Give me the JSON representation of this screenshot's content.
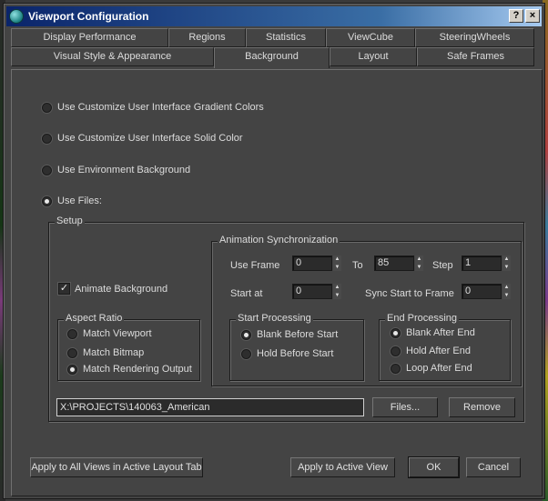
{
  "window": {
    "title": "Viewport Configuration",
    "help_label": "?",
    "close_label": "×"
  },
  "tabs_row1": [
    {
      "label": "Display Performance"
    },
    {
      "label": "Regions"
    },
    {
      "label": "Statistics"
    },
    {
      "label": "ViewCube"
    },
    {
      "label": "SteeringWheels"
    }
  ],
  "tabs_row2": [
    {
      "label": "Visual Style & Appearance"
    },
    {
      "label": "Background",
      "active": true
    },
    {
      "label": "Layout"
    },
    {
      "label": "Safe Frames"
    }
  ],
  "background_options": [
    {
      "label": "Use Customize User Interface Gradient Colors",
      "selected": false
    },
    {
      "label": "Use Customize User Interface Solid Color",
      "selected": false
    },
    {
      "label": "Use Environment Background",
      "selected": false
    },
    {
      "label": "Use Files:",
      "selected": true
    }
  ],
  "setup": {
    "title": "Setup",
    "animate_background": {
      "label": "Animate Background",
      "checked": true,
      "mark": "✓"
    },
    "aspect_ratio": {
      "title": "Aspect Ratio",
      "options": [
        {
          "label": "Match Viewport",
          "selected": false
        },
        {
          "label": "Match Bitmap",
          "selected": false
        },
        {
          "label": "Match Rendering Output",
          "selected": true
        }
      ]
    },
    "anim_sync": {
      "title": "Animation Synchronization",
      "use_frame_label": "Use Frame",
      "use_frame_value": "0",
      "to_label": "To",
      "to_value": "85",
      "step_label": "Step",
      "step_value": "1",
      "start_at_label": "Start at",
      "start_at_value": "0",
      "sync_start_label": "Sync Start to Frame",
      "sync_start_value": "0",
      "start_processing": {
        "title": "Start Processing",
        "options": [
          {
            "label": "Blank Before Start",
            "selected": true
          },
          {
            "label": "Hold Before Start",
            "selected": false
          }
        ]
      },
      "end_processing": {
        "title": "End Processing",
        "options": [
          {
            "label": "Blank After End",
            "selected": true
          },
          {
            "label": "Hold After End",
            "selected": false
          },
          {
            "label": "Loop After End",
            "selected": false
          }
        ]
      }
    },
    "file_path": "X:\\PROJECTS\\140063_American",
    "files_button": "Files...",
    "remove_button": "Remove"
  },
  "footer": {
    "apply_all_label": "Apply to All Views in Active Layout Tab",
    "apply_active_label": "Apply to Active View",
    "ok_label": "OK",
    "cancel_label": "Cancel"
  },
  "arrows": {
    "up": "▲",
    "down": "▼"
  }
}
